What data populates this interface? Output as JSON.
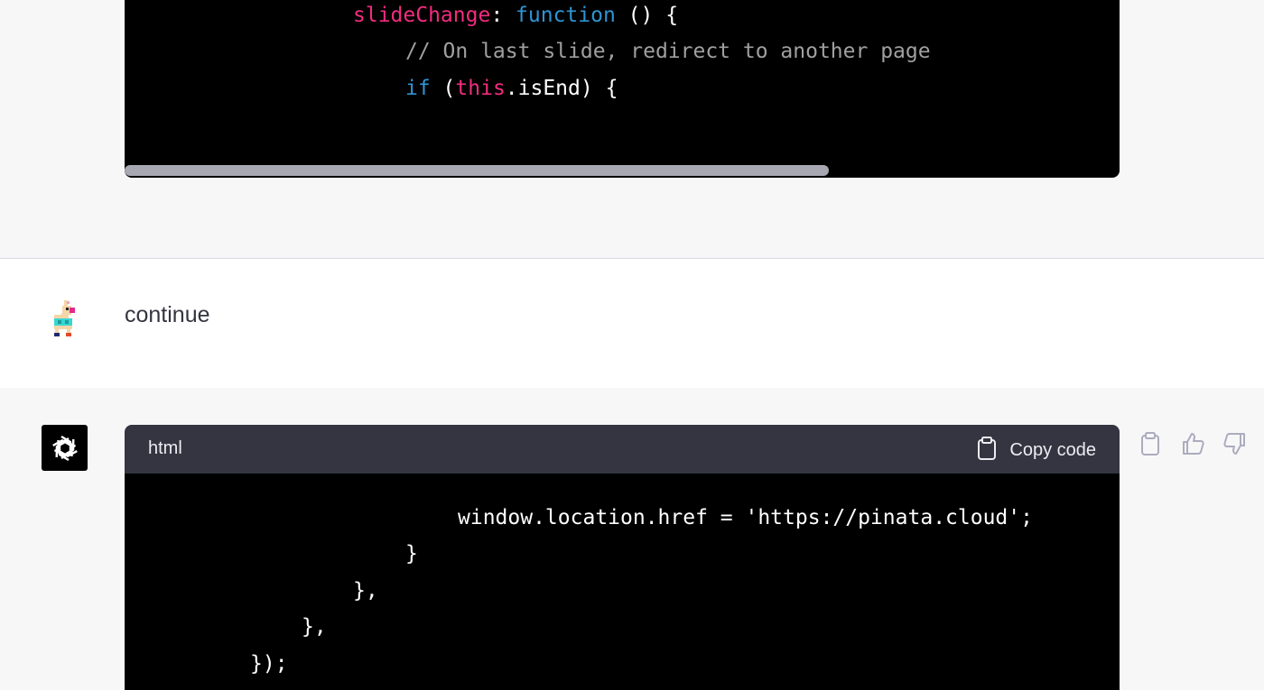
{
  "top_code": {
    "lines": [
      {
        "key": "slideChange",
        "colon": ": ",
        "kw": "function",
        "rest": " () {"
      },
      {
        "comment": "// On last slide, redirect to another page"
      },
      {
        "kw": "if",
        "open": " (",
        "this": "this",
        "rest": ".isEnd) {"
      }
    ]
  },
  "user_turn": {
    "message": "continue",
    "avatar_icon": "llama-avatar-icon"
  },
  "assistant_turn": {
    "avatar_icon": "openai-logo-icon",
    "code_block": {
      "language": "html",
      "copy_label": "Copy code",
      "copy_icon": "clipboard-icon",
      "lines": [
        "window.location.href = 'https://pinata.cloud';",
        "}",
        "},",
        "},",
        "});"
      ]
    },
    "actions": [
      "copy-icon",
      "thumbs-up-icon",
      "thumbs-down-icon"
    ]
  },
  "colors": {
    "code_bg": "#000000",
    "code_header_bg": "#343541",
    "keyword_pink": "#f22c7f",
    "keyword_blue": "#2e95d3",
    "comment_gray": "#a0a0a0"
  }
}
